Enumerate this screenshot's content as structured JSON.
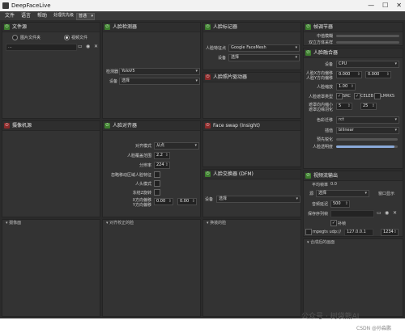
{
  "window": {
    "title": "DeepFaceLive",
    "minimize": "—",
    "maximize": "☐",
    "close": "✕"
  },
  "menu": {
    "file": "文件",
    "language": "语言",
    "help": "帮助",
    "priority_label": "处理优先级",
    "priority_value": "普通"
  },
  "source": {
    "title": "文件源",
    "image_folder": "图片文件夹",
    "video_file": "视频文件",
    "path_value": "..."
  },
  "camera": {
    "title": "摄像机源"
  },
  "detector": {
    "title": "人脸检测器",
    "detector_label": "检测器",
    "detector_value": "YoloV5",
    "device_label": "设备",
    "device_value": "选择"
  },
  "aligner": {
    "title": "人脸对齐器",
    "align_mode_label": "对齐模式",
    "align_mode_value": "从点",
    "face_coverage_label": "人脸覆盖范围",
    "face_coverage_value": "2.2",
    "resolution_label": "分辨率",
    "resolution_value": "224",
    "exclude_moving_label": "忽略移动区域人脸特征",
    "head_mode_label": "人头模式",
    "freeze_z_label": "冻结Z旋转",
    "x_offset_label": "X方向偏移",
    "y_offset_label": "Y方向偏移",
    "x_offset_value": "0.00",
    "y_offset_value": "0.00"
  },
  "marker": {
    "title": "人脸标记器",
    "type_label": "人脸特征点",
    "type_value": "Google FaceMesh",
    "device_label": "设备",
    "device_value": "选择"
  },
  "animator": {
    "title": "人脸照片驱动器"
  },
  "swap_insight": {
    "title": "Face swap (Insight)"
  },
  "swapper": {
    "title": "人脸交换器 (DFM)",
    "device_label": "设备",
    "device_value": "选择"
  },
  "frame_adjuster": {
    "title": "帧调节器",
    "median_blur_label": "中值模糊",
    "bicubic_label": "双立方体采样"
  },
  "merger": {
    "title": "人脸融合器",
    "device_label": "设备",
    "device_value": "CPU",
    "x_offset_label": "人脸X方向偏移",
    "y_offset_label": "人脸Y方向偏移",
    "x_offset_value": "0.000",
    "y_offset_value": "0.000",
    "scale_label": "人脸缩放",
    "scale_value": "1.00",
    "mask_type_label": "人脸遮罩类型",
    "mask_src": "SRC",
    "mask_celeb": "CELEB",
    "mask_lmrks": "LMRKS",
    "erode_label": "遮罩向内缩小",
    "blur_label": "遮罩边缘羽化",
    "erode_value": "5",
    "blur_value": "25",
    "color_transfer_label": "色彩迁移",
    "color_transfer_value": "rct",
    "interpolation_label": "插值",
    "interpolation_value": "bilinear",
    "pre_sharpen_label": "预先锐化",
    "opacity_label": "人脸透明度",
    "opacity": 0.95
  },
  "output": {
    "title": "视频流输出",
    "avg_fps_label": "平均帧率",
    "avg_fps_value": "0.0",
    "source_label": "源",
    "source_value": "选择",
    "window_btn": "窗口显示",
    "delay_label": "音频延迟",
    "delay_value": "500",
    "save_path_label": "保存序列帧",
    "fill_gaps": "补帧",
    "mpegts_label": "mpegts udp://",
    "ip_value": "127.0.0.1",
    "port_value": "1234"
  },
  "bottom": {
    "camera_screen": "摄像面",
    "aligned_face": "对齐校正的脸",
    "swapped_face": "换装的脸",
    "merged_frame": "合成后的画面"
  },
  "watermark": {
    "text": "公众号 · 树袋熊AI",
    "csdn": "CSDN @孙淼鹏"
  }
}
